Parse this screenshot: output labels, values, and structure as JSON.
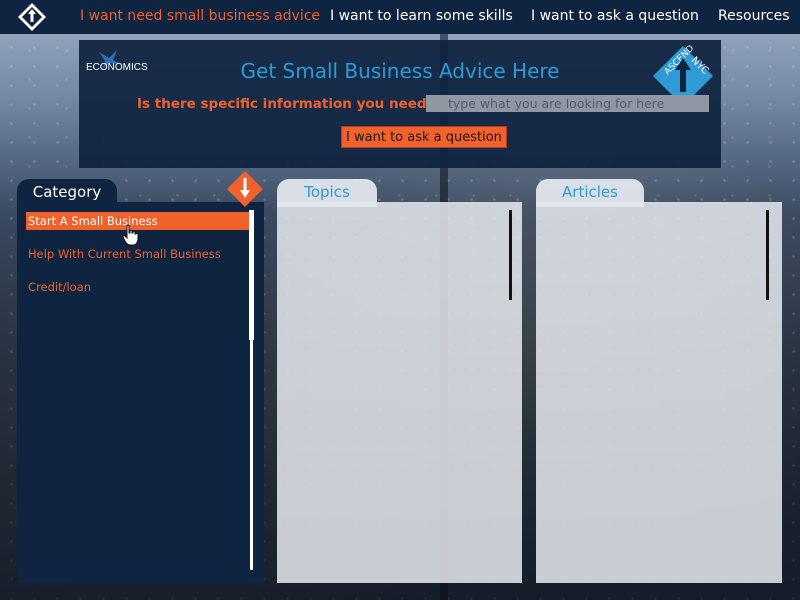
{
  "nav": {
    "items": [
      {
        "label": "I want need small business advice",
        "active": true
      },
      {
        "label": "I want to learn some skills",
        "active": false
      },
      {
        "label": "I want to ask a question",
        "active": false
      },
      {
        "label": "Resources",
        "active": false
      }
    ]
  },
  "header": {
    "logo_left_text": "ECONOMICS",
    "title": "Get Small Business Advice Here",
    "question_label": "Is there specific information you need:",
    "search_placeholder": "type what you are looking for here",
    "search_value": "",
    "ask_button_label": "I want to ask a question",
    "right_logo_text": "ASCEND NYC"
  },
  "category": {
    "tab_label": "Category",
    "items": [
      {
        "label": "Start A Small Business",
        "selected": true
      },
      {
        "label": "Help With Current Small Business",
        "selected": false
      },
      {
        "label": "Credit/loan",
        "selected": false
      }
    ]
  },
  "topics": {
    "tab_label": "Topics"
  },
  "articles": {
    "tab_label": "Articles"
  },
  "colors": {
    "navy": "#0f2440",
    "orange": "#f0612c",
    "blue": "#2e9ad6",
    "light_panel": "#e5e9ef"
  },
  "icons": {
    "nav_logo": "ascend-nyc-logo-icon",
    "left_logo": "eagle-icon",
    "right_logo": "ascend-nyc-logo-icon",
    "category_arrow": "arrow-down-icon",
    "cursor": "hand-pointer-icon"
  }
}
